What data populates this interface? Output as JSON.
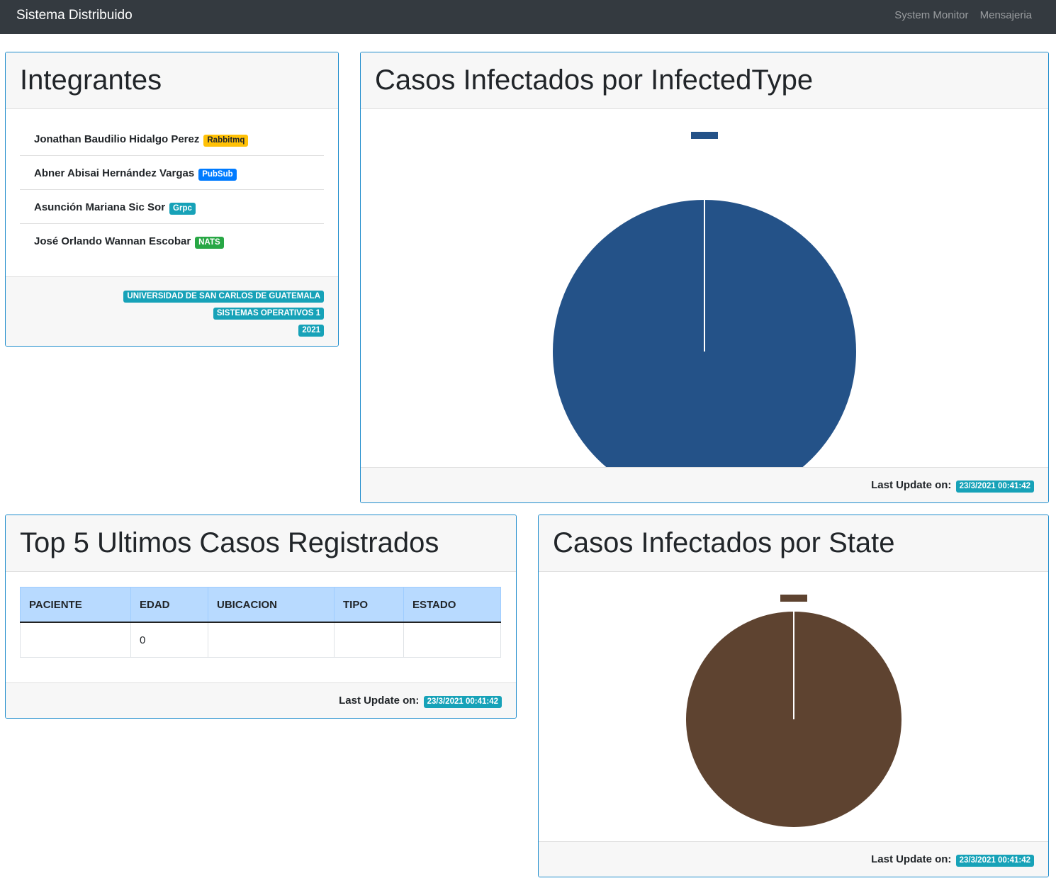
{
  "navbar": {
    "brand": "Sistema Distribuido",
    "links": [
      "System Monitor",
      "Mensajeria"
    ]
  },
  "integrantes": {
    "title": "Integrantes",
    "members": [
      {
        "name": "Jonathan Baudilio Hidalgo Perez",
        "tech": "Rabbitmq",
        "badge_color": "#ffc107"
      },
      {
        "name": "Abner Abisai Hernández Vargas",
        "tech": "PubSub",
        "badge_color": "#007bff"
      },
      {
        "name": "Asunción Mariana Sic Sor",
        "tech": "Grpc",
        "badge_color": "#17a2b8"
      },
      {
        "name": "José Orlando Wannan Escobar",
        "tech": "NATS",
        "badge_color": "#28a745"
      }
    ],
    "footer": [
      "UNIVERSIDAD DE SAN CARLOS DE GUATEMALA",
      "SISTEMAS OPERATIVOS 1",
      "2021"
    ]
  },
  "infected_type": {
    "title": "Casos Infectados por InfectedType",
    "last_update_label": "Last Update on:",
    "last_update": "23/3/2021 00:41:42"
  },
  "top5": {
    "title": "Top 5 Ultimos Casos Registrados",
    "columns": [
      "PACIENTE",
      "EDAD",
      "UBICACION",
      "TIPO",
      "ESTADO"
    ],
    "rows": [
      [
        "",
        "0",
        "",
        "",
        ""
      ]
    ],
    "last_update_label": "Last Update on:",
    "last_update": "23/3/2021 00:41:42"
  },
  "state": {
    "title": "Casos Infectados por State",
    "last_update_label": "Last Update on:",
    "last_update": "23/3/2021 00:41:42"
  },
  "chart_data": [
    {
      "type": "pie",
      "title": "Casos Infectados por InfectedType",
      "categories": [
        ""
      ],
      "values": [
        1
      ],
      "colors": [
        "#245288"
      ],
      "legend": "top"
    },
    {
      "type": "pie",
      "title": "Casos Infectados por State",
      "categories": [
        ""
      ],
      "values": [
        1
      ],
      "colors": [
        "#5e4330"
      ],
      "legend": "top"
    }
  ]
}
